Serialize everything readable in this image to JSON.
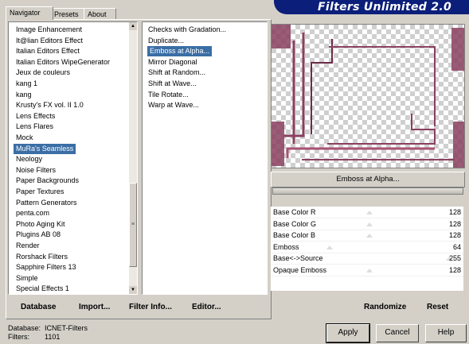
{
  "title": "Filters Unlimited 2.0",
  "tabs": [
    "Navigator",
    "Presets",
    "About"
  ],
  "categories": [
    "Image Enhancement",
    "It@lian Editors Effect",
    "Italian Editors Effect",
    "Italian Editors WipeGenerator",
    "Jeux de couleurs",
    "kang 1",
    "kang",
    "Krusty's FX vol. II 1.0",
    "Lens Effects",
    "Lens Flares",
    "Mock",
    "MuRa's Seamless",
    "Neology",
    "Noise Filters",
    "Paper Backgrounds",
    "Paper Textures",
    "Pattern Generators",
    "penta.com",
    "Photo Aging Kit",
    "Plugins AB 08",
    "Render",
    "Rorshack Filters",
    "Sapphire Filters 13",
    "Simple",
    "Special Effects 1"
  ],
  "selected_category": "MuRa's Seamless",
  "filters": [
    "Checks with Gradation...",
    "Duplicate...",
    "Emboss at Alpha...",
    "Mirror Diagonal",
    "Shift at Random...",
    "Shift at Wave...",
    "Tile Rotate...",
    "Warp at Wave..."
  ],
  "selected_filter": "Emboss at Alpha...",
  "bottom_left": {
    "database": "Database",
    "import": "Import...",
    "filter_info": "Filter Info...",
    "editor": "Editor..."
  },
  "filter_name": "Emboss at Alpha...",
  "params": [
    {
      "label": "Base Color R",
      "value": "128"
    },
    {
      "label": "Base Color G",
      "value": "128"
    },
    {
      "label": "Base Color B",
      "value": "128"
    },
    {
      "label": "Emboss",
      "value": "64"
    },
    {
      "label": "Base<->Source",
      "value": "255"
    },
    {
      "label": "Opaque Emboss",
      "value": "128"
    }
  ],
  "randomize": "Randomize",
  "reset": "Reset",
  "status": {
    "database_label": "Database:",
    "database_value": "ICNET-Filters",
    "filters_label": "Filters:",
    "filters_value": "1101"
  },
  "buttons": {
    "apply": "Apply",
    "cancel": "Cancel",
    "help": "Help"
  },
  "colors": {
    "selection": "#3a6ea5",
    "banner": "#0b1f7a",
    "preview_accent": "#8a3f5f"
  }
}
